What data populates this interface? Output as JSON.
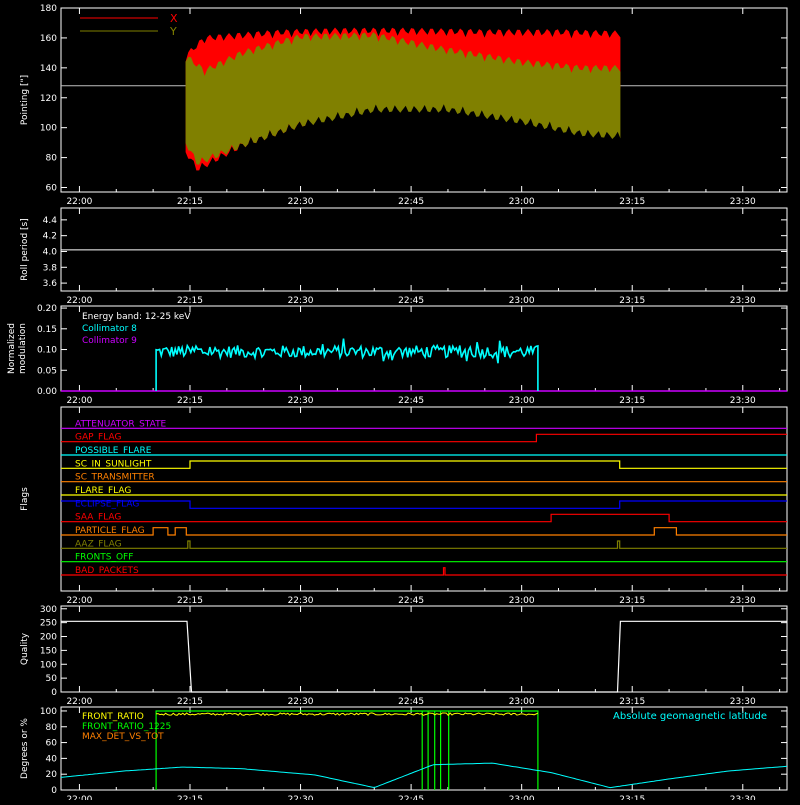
{
  "colors": {
    "frame": "#ffffff",
    "red": "#ff0000",
    "olive": "#808000",
    "cyan": "#00ffff",
    "magenta": "#cc00ff",
    "yellow": "#ffff00",
    "green": "#00ff00",
    "orange": "#ff8000",
    "blue": "#0000ff"
  },
  "time_ticks": [
    "22:00",
    "22:15",
    "22:30",
    "22:45",
    "23:00",
    "23:15",
    "23:30"
  ],
  "time_tick_minutes": [
    0,
    15,
    30,
    45,
    60,
    75,
    90
  ],
  "time_range_minutes": [
    -2.5,
    96
  ],
  "chart_data": [
    {
      "type": "area",
      "ylabel": "Pointing [\"]",
      "ylim": [
        57,
        180
      ],
      "yticks": [
        "60",
        "80",
        "100",
        "120",
        "140",
        "160",
        "180"
      ],
      "ytick_values": [
        60,
        80,
        100,
        120,
        140,
        160,
        180
      ],
      "reference_line_y": 128,
      "legend_position": "top-left",
      "series": [
        {
          "name": "X",
          "color": "red",
          "start_min": 14.4,
          "end_min": 73.4,
          "upper_env": [
            [
              14.4,
              150
            ],
            [
              17,
              162
            ],
            [
              22,
              164
            ],
            [
              28,
              166
            ],
            [
              35,
              167
            ],
            [
              45,
              167
            ],
            [
              55,
              166
            ],
            [
              65,
              166
            ],
            [
              73.4,
              165
            ]
          ],
          "lower_env": [
            [
              14.4,
              82
            ],
            [
              16,
              70
            ],
            [
              22,
              86
            ],
            [
              30,
              100
            ],
            [
              40,
              112
            ],
            [
              50,
              120
            ],
            [
              60,
              125
            ],
            [
              68,
              127
            ],
            [
              73.4,
              125
            ]
          ]
        },
        {
          "name": "Y",
          "color": "olive",
          "start_min": 14.4,
          "end_min": 73.4,
          "upper_env": [
            [
              14.4,
              150
            ],
            [
              17,
              140
            ],
            [
              22,
              152
            ],
            [
              30,
              163
            ],
            [
              40,
              164
            ],
            [
              50,
              154
            ],
            [
              60,
              146
            ],
            [
              68,
              142
            ],
            [
              73.4,
              142
            ]
          ],
          "lower_env": [
            [
              14.4,
              88
            ],
            [
              16,
              74
            ],
            [
              22,
              86
            ],
            [
              30,
              100
            ],
            [
              40,
              110
            ],
            [
              50,
              110
            ],
            [
              60,
              102
            ],
            [
              68,
              94
            ],
            [
              73.4,
              92
            ]
          ]
        }
      ]
    },
    {
      "type": "line",
      "ylabel": "Roll period [s]",
      "ylim": [
        3.5,
        4.55
      ],
      "yticks": [
        "3.6",
        "3.8",
        "4.0",
        "4.2",
        "4.4"
      ],
      "ytick_values": [
        3.6,
        3.8,
        4.0,
        4.2,
        4.4
      ],
      "series": [
        {
          "name": "",
          "color": "frame",
          "x": [
            -2.5,
            96
          ],
          "y": [
            4.02,
            4.02
          ]
        }
      ]
    },
    {
      "type": "line",
      "ylabel": "Normalized modulation",
      "ylim": [
        0,
        0.205
      ],
      "yticks": [
        "0.00",
        "0.05",
        "0.10",
        "0.15",
        "0.20"
      ],
      "ytick_values": [
        0,
        0.05,
        0.1,
        0.15,
        0.2
      ],
      "annotation": "Energy band: 12-25 keV",
      "legend_position": "top-left",
      "series": [
        {
          "name": "Collimator 8",
          "color": "cyan",
          "start_min": 10.4,
          "end_min": 62.2,
          "baseline": 0.095,
          "noise": 0.03
        },
        {
          "name": "Collimator 9",
          "color": "magenta",
          "x": [
            -2.5,
            96
          ],
          "y": [
            0,
            0
          ]
        }
      ]
    },
    {
      "type": "line",
      "ylabel": "Flags",
      "ylim": [
        0,
        13
      ],
      "flags": [
        {
          "name": "ATTENUATOR_STATE",
          "color": "magenta",
          "steps": [
            [
              -2.5,
              0
            ]
          ]
        },
        {
          "name": "GAP_FLAG",
          "color": "red",
          "steps": [
            [
              -2.5,
              0
            ],
            [
              62,
              1
            ]
          ]
        },
        {
          "name": "POSSIBLE_FLARE",
          "color": "cyan",
          "steps": [
            [
              -2.5,
              0
            ]
          ]
        },
        {
          "name": "SC_IN_SUNLIGHT",
          "color": "yellow",
          "steps": [
            [
              -2.5,
              0
            ],
            [
              15,
              1
            ],
            [
              73.3,
              0
            ]
          ]
        },
        {
          "name": "SC_TRANSMITTER",
          "color": "orange",
          "steps": [
            [
              -2.5,
              0
            ]
          ]
        },
        {
          "name": "FLARE_FLAG",
          "color": "yellow",
          "steps": [
            [
              -2.5,
              0
            ]
          ]
        },
        {
          "name": "ECLIPSE_FLAG",
          "color": "blue",
          "steps": [
            [
              -2.5,
              1
            ],
            [
              15,
              0
            ],
            [
              73.3,
              1
            ]
          ]
        },
        {
          "name": "SAA_FLAG",
          "color": "red",
          "steps": [
            [
              -2.5,
              0
            ],
            [
              64,
              1
            ],
            [
              80,
              0
            ]
          ]
        },
        {
          "name": "PARTICLE_FLAG",
          "color": "orange",
          "steps": [
            [
              -2.5,
              0
            ],
            [
              10,
              1
            ],
            [
              12,
              0
            ],
            [
              13,
              1
            ],
            [
              14.5,
              0
            ],
            [
              78,
              1
            ],
            [
              81,
              0
            ]
          ]
        },
        {
          "name": "AAZ_FLAG",
          "color": "olive",
          "steps": [
            [
              -2.5,
              0
            ],
            [
              14.7,
              1
            ],
            [
              15,
              0
            ],
            [
              73,
              1
            ],
            [
              73.3,
              0
            ]
          ]
        },
        {
          "name": "FRONTS_OFF",
          "color": "green",
          "steps": [
            [
              -2.5,
              0
            ]
          ]
        },
        {
          "name": "BAD_PACKETS",
          "color": "red",
          "steps": [
            [
              -2.5,
              0
            ],
            [
              49.4,
              1
            ],
            [
              49.6,
              0
            ]
          ]
        }
      ]
    },
    {
      "type": "line",
      "ylabel": "Quality",
      "ylim": [
        0,
        310
      ],
      "yticks": [
        "0",
        "50",
        "100",
        "150",
        "200",
        "250",
        "300"
      ],
      "ytick_values": [
        0,
        50,
        100,
        150,
        200,
        250,
        300
      ],
      "series": [
        {
          "name": "",
          "color": "frame",
          "x": [
            -2.5,
            14.6,
            15.2,
            73.0,
            73.4,
            96
          ],
          "y": [
            255,
            255,
            0,
            0,
            255,
            255
          ]
        }
      ]
    },
    {
      "type": "line",
      "ylabel": "Degrees or %",
      "ylim": [
        0,
        105
      ],
      "yticks": [
        "0",
        "20",
        "40",
        "60",
        "80",
        "100"
      ],
      "ytick_values": [
        0,
        20,
        40,
        60,
        80,
        100
      ],
      "annotation": "Absolute geomagnetic latitude",
      "legend_position": "top-left",
      "series": [
        {
          "name": "FRONT_RATIO",
          "color": "yellow",
          "start_min": 10.4,
          "end_min": 62.2,
          "baseline": 96
        },
        {
          "name": "FRONT_RATIO_1225",
          "color": "green",
          "start_min": 10.4,
          "end_min": 62.2,
          "baseline": 100
        },
        {
          "name": "MAX_DET_VS_TOT",
          "color": "orange",
          "x": [
            -2.5,
            96
          ],
          "y": [
            0,
            0
          ]
        },
        {
          "name": "Absolute geomagnetic latitude",
          "color": "cyan",
          "x": [
            -2.5,
            6,
            14,
            22,
            32,
            40,
            48,
            56,
            64,
            72,
            80,
            88,
            96
          ],
          "y": [
            16,
            24,
            29,
            27,
            19,
            3,
            32,
            34,
            22,
            3,
            14,
            24,
            30
          ]
        }
      ]
    }
  ]
}
